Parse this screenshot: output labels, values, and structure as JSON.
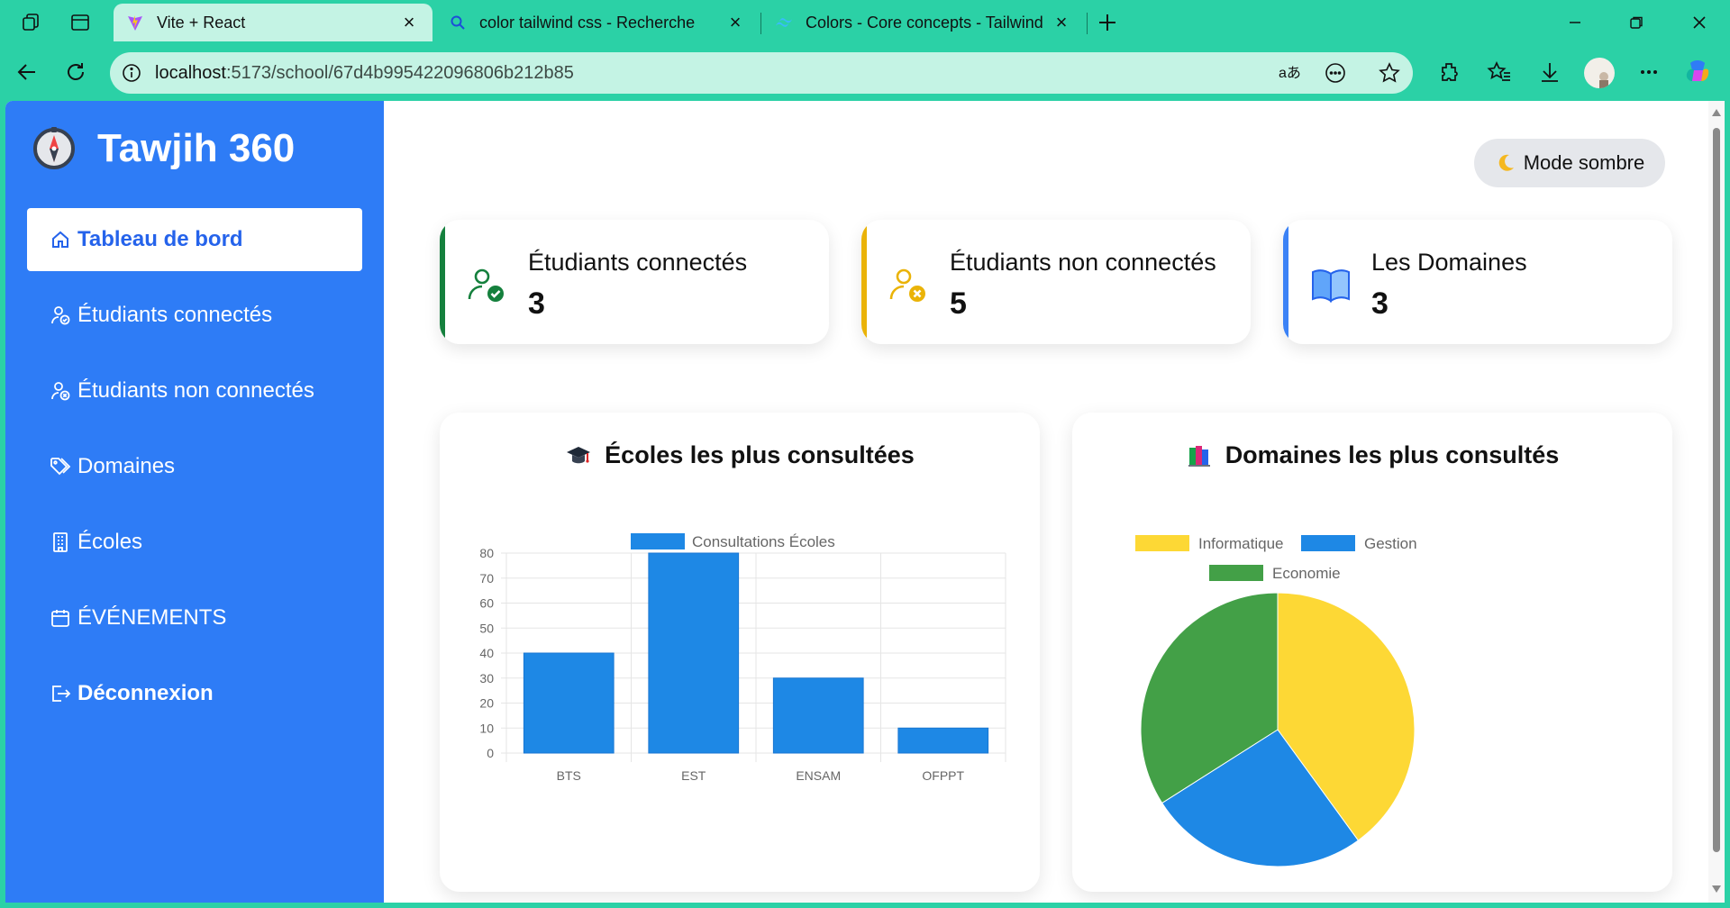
{
  "browser": {
    "tabs": [
      {
        "title": "Vite + React",
        "active": true
      },
      {
        "title": "color tailwind css - Recherche",
        "active": false
      },
      {
        "title": "Colors - Core concepts - Tailwind",
        "active": false
      }
    ],
    "url_host": "localhost",
    "url_path": ":5173/school/67d4b995422096806b212b85"
  },
  "sidebar": {
    "brand": "Tawjih 360",
    "items": [
      {
        "label": "Tableau de bord",
        "icon": "home-icon"
      },
      {
        "label": "Étudiants connectés",
        "icon": "user-check-icon"
      },
      {
        "label": "Étudiants non connectés",
        "icon": "user-x-icon"
      },
      {
        "label": "Domaines",
        "icon": "tags-icon"
      },
      {
        "label": "Écoles",
        "icon": "building-icon"
      },
      {
        "label": "ÉVÉNEMENTS",
        "icon": "calendar-icon"
      },
      {
        "label": "Déconnexion",
        "icon": "logout-icon"
      }
    ]
  },
  "header": {
    "mode_button": "Mode sombre"
  },
  "stats": [
    {
      "title": "Étudiants connectés",
      "value": "3",
      "color": "#15803d",
      "icon": "user-check-icon"
    },
    {
      "title": "Étudiants non connectés",
      "value": "5",
      "color": "#eab308",
      "icon": "user-x-icon"
    },
    {
      "title": "Les Domaines",
      "value": "3",
      "color": "#3b82f6",
      "icon": "book-icon"
    }
  ],
  "charts": {
    "schools_title": "Écoles les plus consultées",
    "domains_title": "Domaines les plus consultés"
  },
  "chart_data": [
    {
      "type": "bar",
      "title": "Écoles les plus consultées",
      "categories": [
        "BTS",
        "EST",
        "ENSAM",
        "OFPPT"
      ],
      "series": [
        {
          "name": "Consultations Écoles",
          "values": [
            40,
            80,
            30,
            10
          ]
        }
      ],
      "ylim": [
        0,
        80
      ],
      "yticks": [
        0,
        10,
        20,
        30,
        40,
        50,
        60,
        70,
        80
      ],
      "grid": true,
      "legend": "top",
      "color": "#1e88e5"
    },
    {
      "type": "pie",
      "title": "Domaines les plus consultés",
      "labels": [
        "Informatique",
        "Gestion",
        "Economie"
      ],
      "values": [
        40,
        26,
        34
      ],
      "colors": [
        "#fdd835",
        "#1e88e5",
        "#43a047"
      ],
      "legend": "top"
    }
  ]
}
